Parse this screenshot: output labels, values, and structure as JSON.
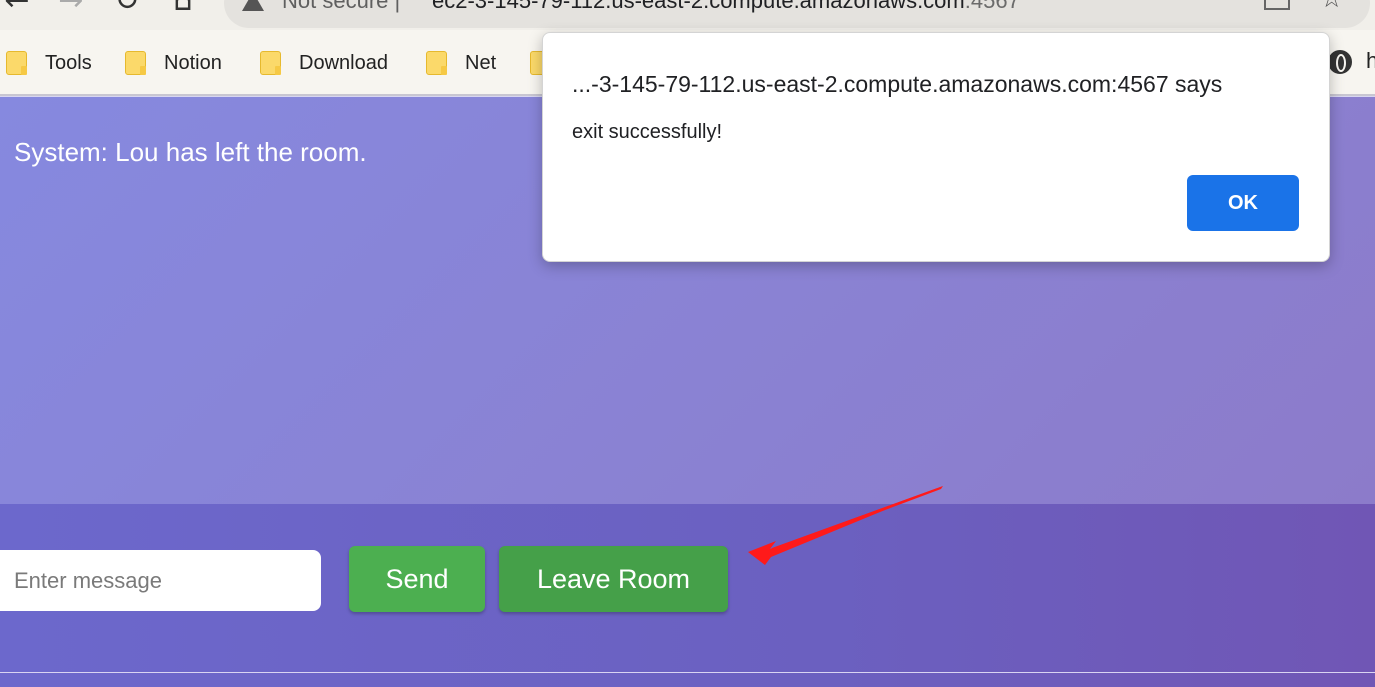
{
  "browser": {
    "security_label": "Not secure",
    "url_host": "ec2-3-145-79-112.us-east-2.compute.amazonaws.com",
    "url_port": ":4567",
    "bookmarks": [
      {
        "label": "Tools"
      },
      {
        "label": "Notion"
      },
      {
        "label": "Download"
      },
      {
        "label": "Net"
      }
    ],
    "bookmarks_overflow": "h"
  },
  "chat": {
    "messages": [
      "System: Lou has left the room."
    ]
  },
  "composer": {
    "placeholder": "Enter message",
    "send_label": "Send",
    "leave_label": "Leave Room"
  },
  "dialog": {
    "title": "...-3-145-79-112.us-east-2.compute.amazonaws.com:4567 says",
    "message": "exit successfully!",
    "ok_label": "OK"
  },
  "colors": {
    "send_button": "#4caf50",
    "leave_button": "#45a049",
    "ok_button": "#1a73e8",
    "annotation_arrow": "#ff1a1a"
  }
}
